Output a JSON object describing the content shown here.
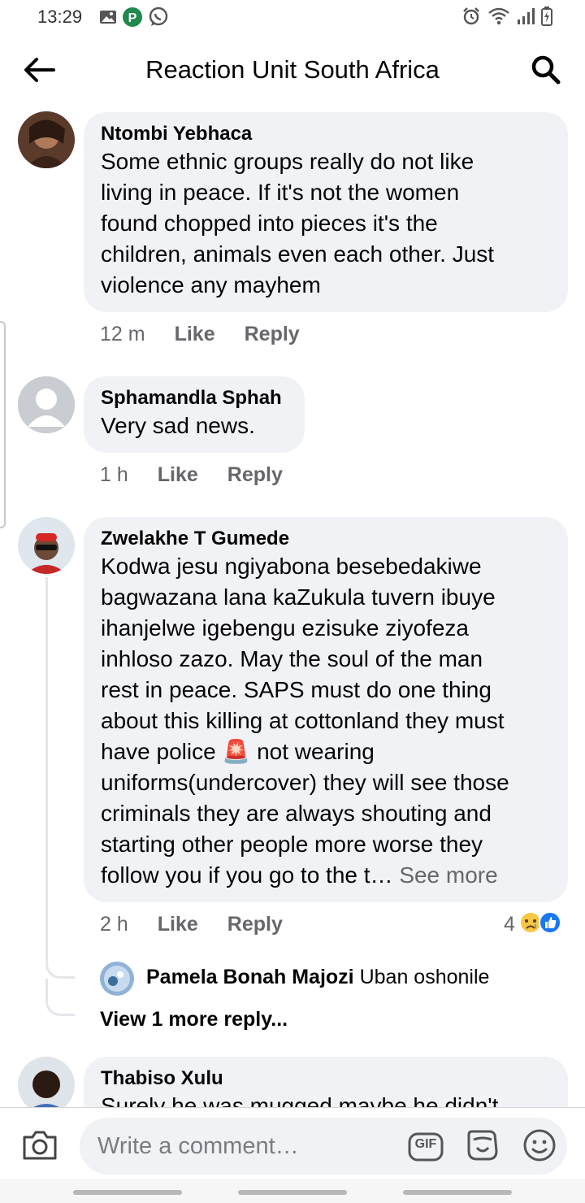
{
  "status_bar": {
    "time": "13:29",
    "left_icons": [
      "gallery-icon",
      "parking-app-icon",
      "whatsapp-icon"
    ],
    "right_icons": [
      "alarm-icon",
      "wifi-icon",
      "signal-icon",
      "battery-charging-icon"
    ]
  },
  "header": {
    "title": "Reaction Unit South Africa",
    "back_icon": "arrow-left-icon",
    "search_icon": "search-icon"
  },
  "comments": [
    {
      "author": "Ntombi Yebhaca",
      "lines": [
        "Some ethnic groups really do not like",
        "living in peace. If it's not the women",
        "found chopped into pieces it's the",
        "children, animals even each other. Just",
        "violence any mayhem"
      ],
      "time": "12 m",
      "like_label": "Like",
      "reply_label": "Reply"
    },
    {
      "author": "Sphamandla Sphah",
      "lines": [
        "Very sad news."
      ],
      "time": "1 h",
      "like_label": "Like",
      "reply_label": "Reply"
    },
    {
      "author": "Zwelakhe T Gumede",
      "lines": [
        "Kodwa jesu ngiyabona besebedakiwe",
        "bagwazana lana kaZukula tuvern ibuye",
        "ihanjelwe igebengu ezisuke ziyofeza",
        "inhloso zazo. May the soul of the man",
        "rest in peace. SAPS must do one thing",
        "about this killing at cottonland they must",
        "have police 🚨 not wearing",
        "uniforms(undercover) they will see those",
        "criminals they are always shouting and",
        "starting other people more worse they",
        "follow you if you go to the t…"
      ],
      "see_more": "See more",
      "time": "2 h",
      "like_label": "Like",
      "reply_label": "Reply",
      "reaction_count": "4",
      "reaction_icons": [
        "sad-reaction-icon",
        "like-reaction-icon"
      ],
      "reply_preview": {
        "author": "Pamela Bonah Majozi",
        "text": "Uban oshonile"
      },
      "more_replies_label": "View 1 more reply..."
    },
    {
      "author": "Thabiso Xulu",
      "partial_text": "Surely he was mugged maybe he didn't"
    }
  ],
  "composer": {
    "placeholder": "Write a comment…",
    "camera_icon": "camera-icon",
    "gif_label": "GIF",
    "sticker_icon": "sticker-icon",
    "emoji_icon": "emoji-icon"
  }
}
